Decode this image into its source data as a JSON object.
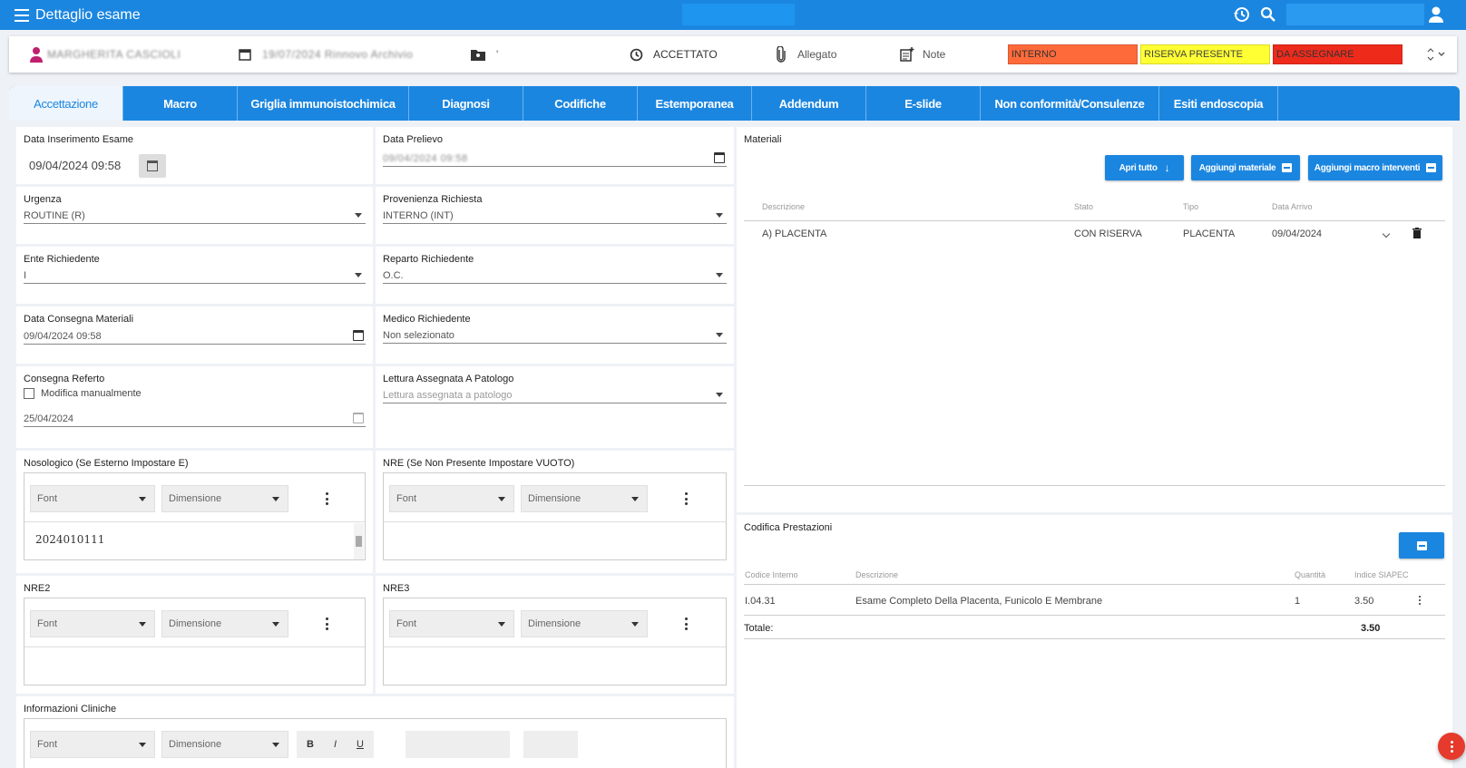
{
  "app": {
    "title": "Dettaglio esame"
  },
  "header": {
    "patient_name": "MARGHERITA CASCIOLI",
    "exam_date_info": "19/07/2024 Rinnovo Archivio",
    "folder_suffix": "'",
    "status": "ACCETTATO",
    "allegato": "Allegato",
    "note": "Note",
    "badges": [
      {
        "label": "INTERNO",
        "color": "#ff6a3a"
      },
      {
        "label": "RISERVA PRESENTE",
        "color": "#ffff33"
      },
      {
        "label": "DA ASSEGNARE",
        "color": "#ee2b1b"
      }
    ]
  },
  "tabs": [
    "Accettazione",
    "Macro",
    "Griglia immunoistochimica",
    "Diagnosi",
    "Codifiche",
    "Estemporanea",
    "Addendum",
    "E-slide",
    "Non conformità/Consulenze",
    "Esiti endoscopia"
  ],
  "form": {
    "data_inserimento": {
      "label": "Data Inserimento Esame",
      "value": "09/04/2024 09:58"
    },
    "data_prelievo": {
      "label": "Data Prelievo",
      "value": "09/04/2024 09:58"
    },
    "urgenza": {
      "label": "Urgenza",
      "value": "ROUTINE (R)"
    },
    "provenienza": {
      "label": "Provenienza Richiesta",
      "value": "INTERNO (INT)"
    },
    "ente": {
      "label": "Ente Richiedente",
      "value": "I"
    },
    "reparto": {
      "label": "Reparto Richiedente",
      "value": "O.C."
    },
    "data_consegna": {
      "label": "Data Consegna Materiali",
      "value": "09/04/2024 09:58"
    },
    "medico": {
      "label": "Medico Richiedente",
      "value": "Non selezionato"
    },
    "consegna_referto": {
      "label": "Consegna Referto",
      "checkbox": "Modifica manualmente",
      "value": "25/04/2024"
    },
    "lettura": {
      "label": "Lettura Assegnata A Patologo",
      "placeholder": "Lettura assegnata a patologo"
    },
    "nosologico": {
      "label": "Nosologico (Se Esterno Impostare E)",
      "value": "2024010111"
    },
    "nre": {
      "label": "NRE (Se Non Presente Impostare VUOTO)"
    },
    "nre2": {
      "label": "NRE2"
    },
    "nre3": {
      "label": "NRE3"
    },
    "info_cliniche": {
      "label": "Informazioni Cliniche"
    },
    "editor_font": "Font",
    "editor_dim": "Dimensione"
  },
  "materiali": {
    "title": "Materiali",
    "btn_apri": "Apri tutto",
    "btn_aggiungi": "Aggiungi materiale",
    "btn_macro": "Aggiungi macro interventi",
    "columns": [
      "Descrizione",
      "Stato",
      "Tipo",
      "Data Arrivo"
    ],
    "rows": [
      {
        "descrizione": "A) PLACENTA",
        "stato": "CON RISERVA",
        "tipo": "PLACENTA",
        "data": "09/04/2024"
      }
    ]
  },
  "codifica": {
    "title": "Codifica Prestazioni",
    "columns": [
      "Codice Interno",
      "Descrizione",
      "Quantità",
      "Indice SIAPEC"
    ],
    "rows": [
      {
        "codice": "I.04.31",
        "descrizione": "Esame Completo Della Placenta, Funicolo E Membrane",
        "quantita": "1",
        "indice": "3.50"
      }
    ],
    "totale_label": "Totale:",
    "totale_value": "3.50"
  }
}
